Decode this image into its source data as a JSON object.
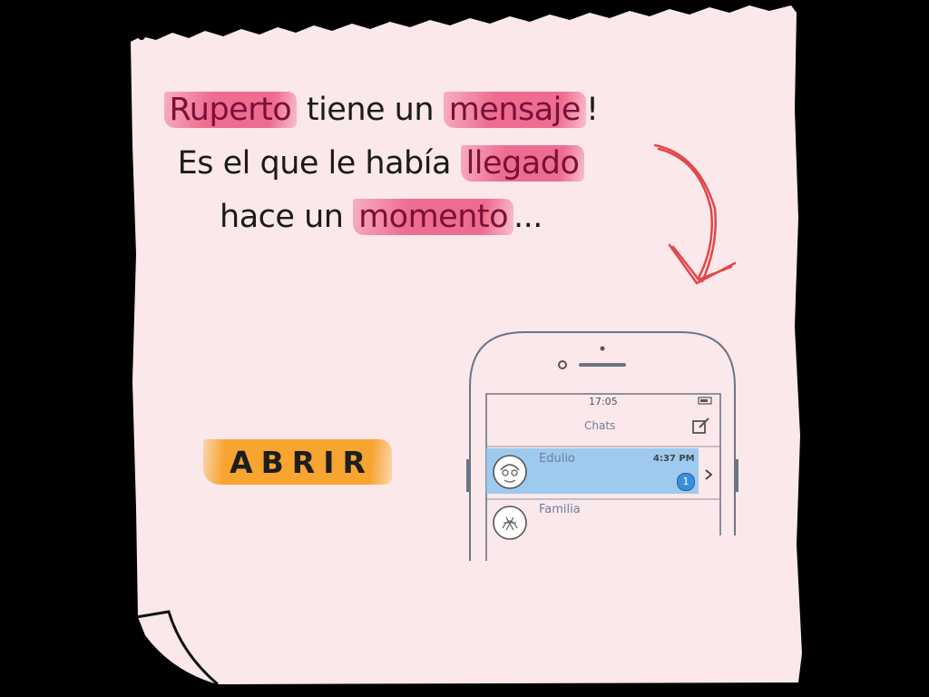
{
  "story": {
    "w1": "Ruperto",
    "t1": " tiene un ",
    "w2": "mensaje",
    "t2": "! Es el que le había ",
    "w3": "llegado",
    "t3": " hace un ",
    "w4": "momento",
    "t4": "..."
  },
  "open_button": {
    "label": "ABRIR"
  },
  "phone": {
    "time": "17:05",
    "title": "Chats",
    "chats": [
      {
        "name": "Edulio",
        "time": "4:37 PM",
        "unread": "1"
      },
      {
        "name": "Familia"
      }
    ]
  },
  "colors": {
    "paper": "#fbe8ea",
    "highlight_pink": "#ec5680",
    "button_orange": "#f7a026",
    "chat_highlight": "#8cc4ee",
    "arrow_red": "#e0484a"
  }
}
